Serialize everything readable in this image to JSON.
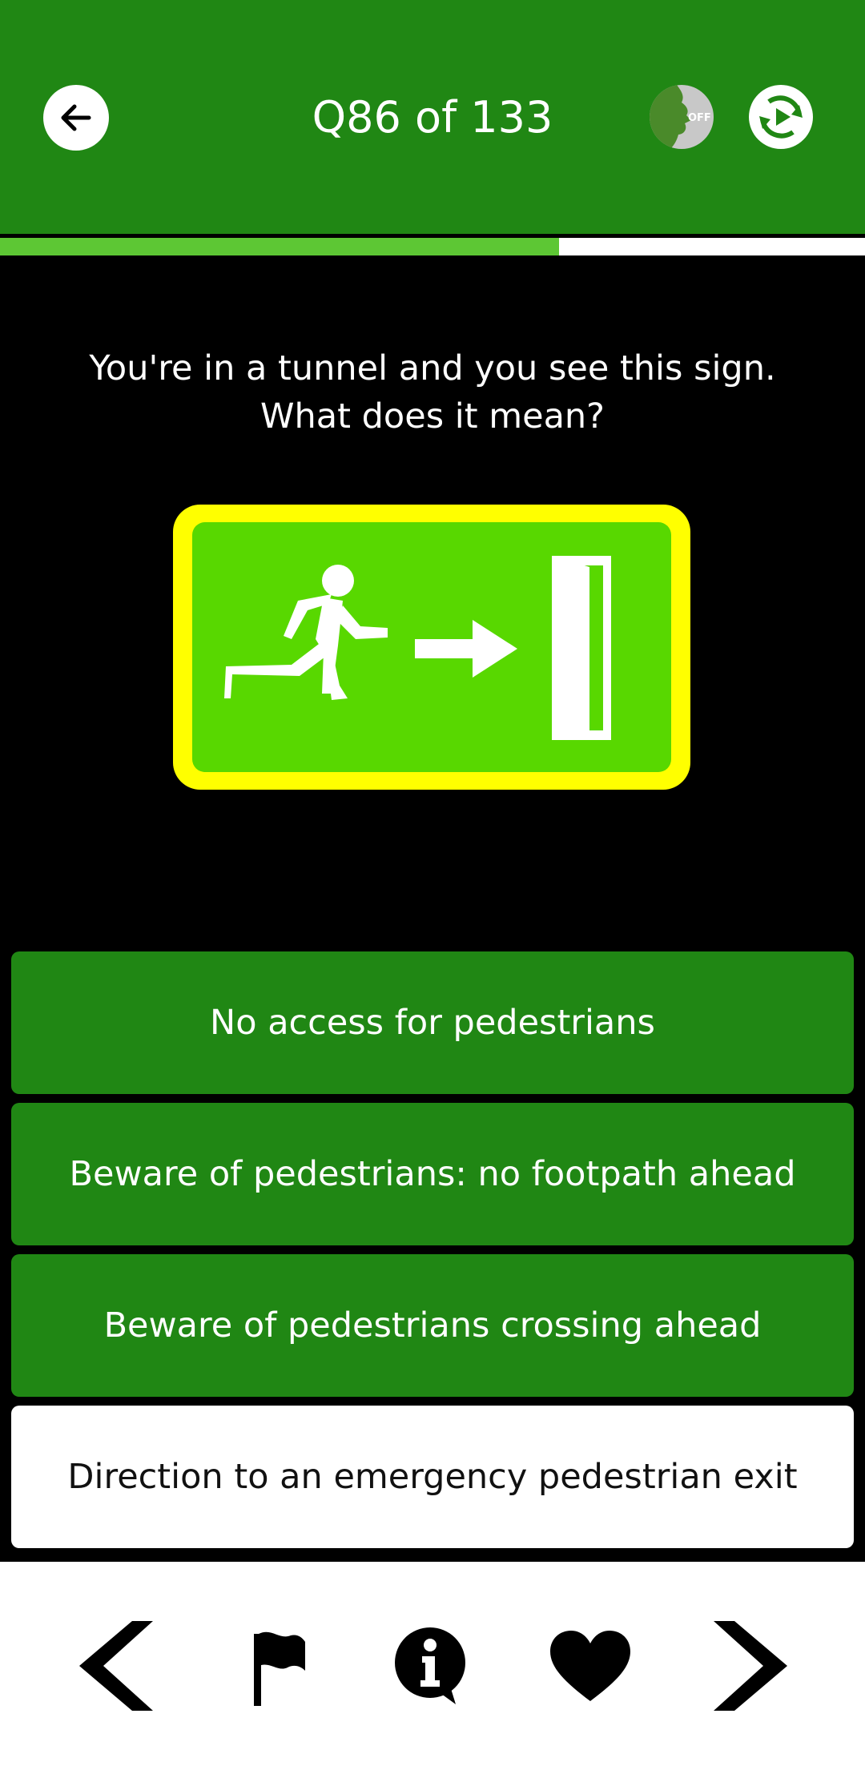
{
  "header": {
    "title": "Q86 of 133",
    "voice_toggle_label": "OFF",
    "background_color": "#208714"
  },
  "progress": {
    "current": 86,
    "total": 133,
    "fraction": 0.6466,
    "fill_color": "#5dc734"
  },
  "question": {
    "line1": "You're in a tunnel and you see this sign.",
    "line2": "What does it mean?"
  },
  "sign": {
    "description": "emergency-exit-sign",
    "background_color": "#58d800",
    "border_color": "#ffff00"
  },
  "answers": [
    {
      "label": "No access for pedestrians",
      "selected": false
    },
    {
      "label": "Beware of pedestrians: no footpath ahead",
      "selected": false
    },
    {
      "label": "Beware of pedestrians crossing ahead",
      "selected": false
    },
    {
      "label": "Direction to an emergency pedestrian exit",
      "selected": true
    }
  ],
  "bottom_nav": {
    "icons": [
      "chevron-left-icon",
      "flag-icon",
      "info-bubble-icon",
      "heart-icon",
      "chevron-right-icon"
    ]
  }
}
